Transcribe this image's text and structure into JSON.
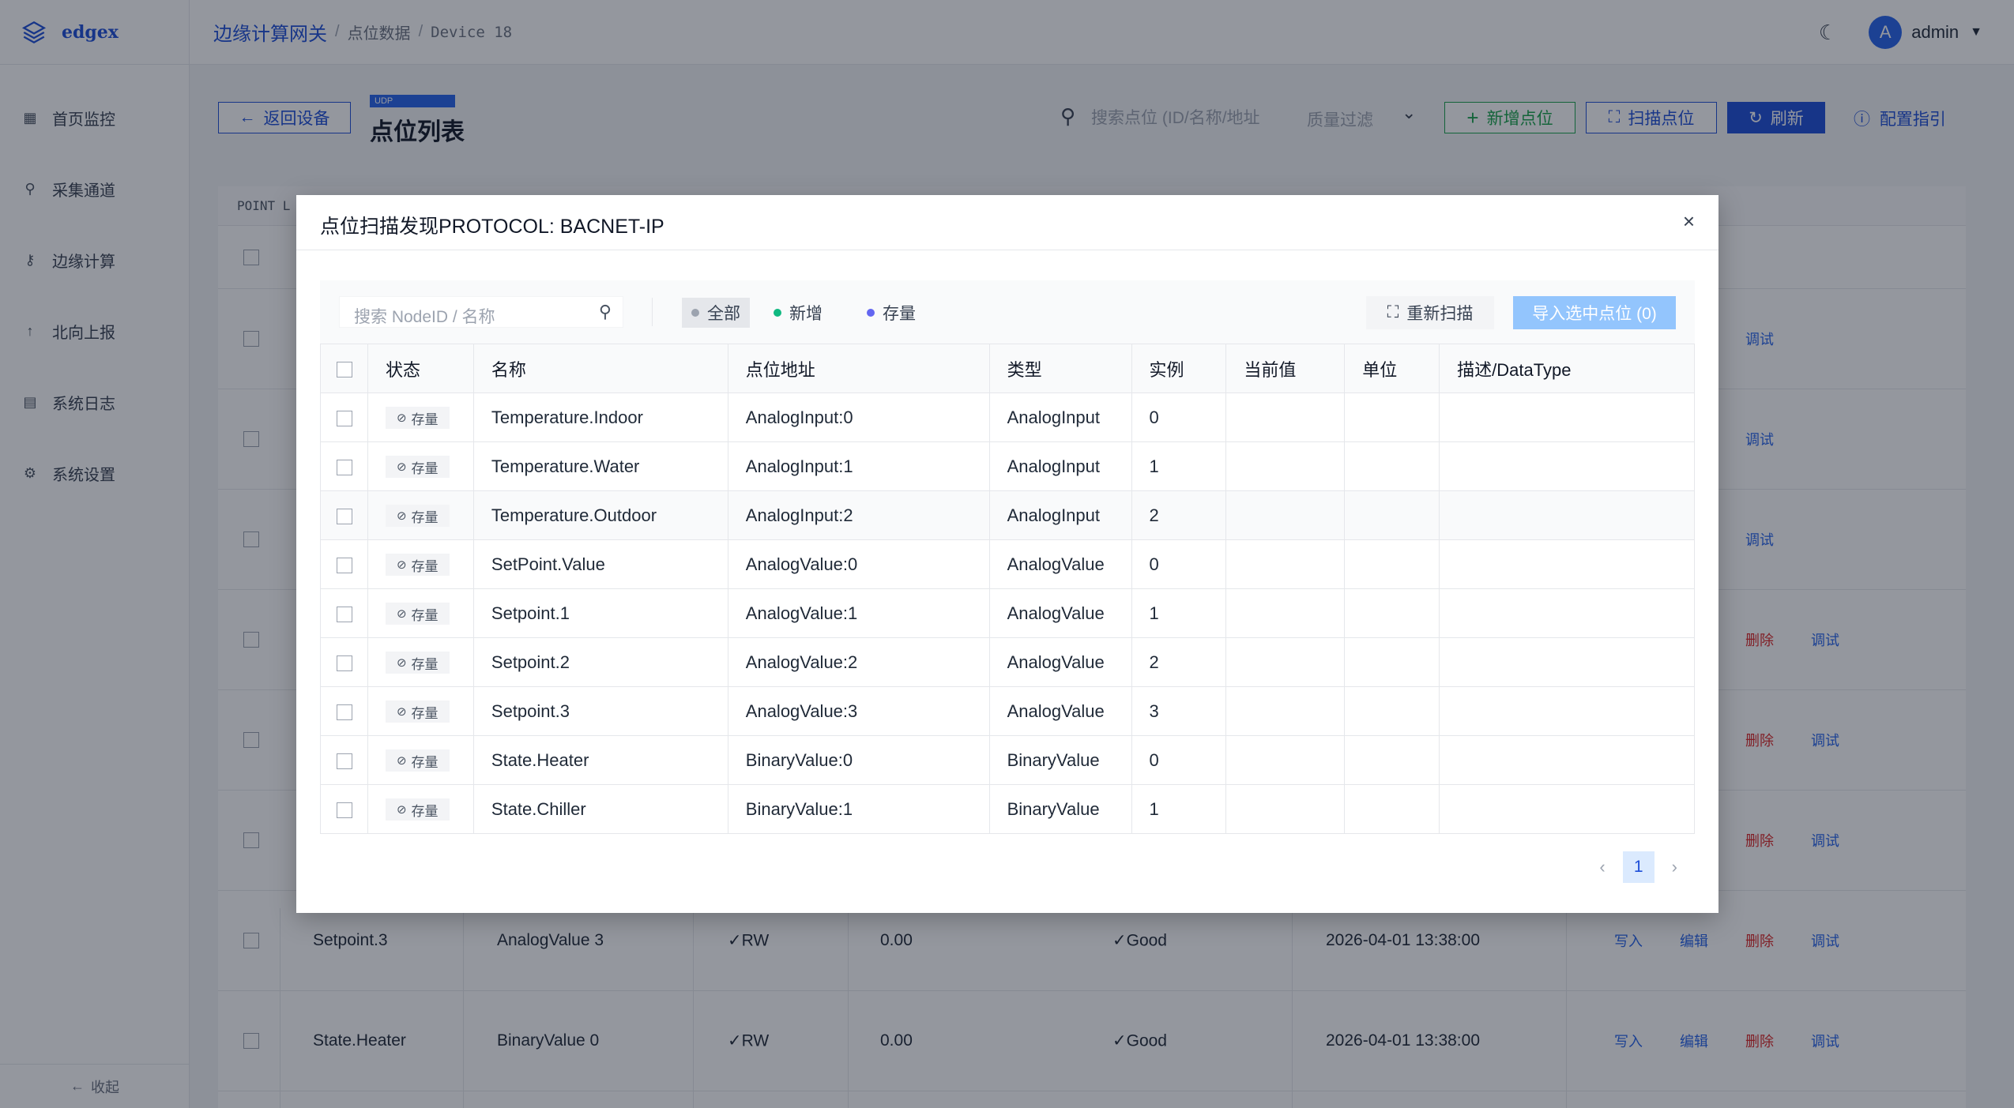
{
  "app": {
    "brand": "edgex"
  },
  "sidebar": {
    "items": [
      {
        "icon": "grid-icon",
        "label": "首页监控"
      },
      {
        "icon": "link-icon",
        "label": "采集通道"
      },
      {
        "icon": "key-icon",
        "label": "边缘计算"
      },
      {
        "icon": "arrow-up-icon",
        "label": "北向上报"
      },
      {
        "icon": "doc-icon",
        "label": "系统日志"
      },
      {
        "icon": "gear-icon",
        "label": "系统设置"
      }
    ],
    "collapse_label": "收起"
  },
  "header": {
    "breadcrumbs": [
      "边缘计算网关",
      "点位数据",
      "Device 18"
    ],
    "user": {
      "initial": "A",
      "name": "admin"
    }
  },
  "toolbar": {
    "back_label": "返回设备",
    "protocol_tag": "UDP",
    "title": "点位列表",
    "search_placeholder": "搜索点位 (ID/名称/地址",
    "quality_filter_placeholder": "质量过滤",
    "add_label": "新增点位",
    "scan_label": "扫描点位",
    "refresh_label": "刷新",
    "guide_label": "配置指引"
  },
  "background_table": {
    "header_fragment": "POINT L",
    "rows": [
      {
        "name": "",
        "address": "",
        "rw": "",
        "value": "",
        "quality": "",
        "time": "",
        "actions": [
          "调试"
        ]
      },
      {
        "name": "",
        "address": "",
        "rw": "",
        "value": "",
        "quality": "",
        "time": "",
        "actions": [
          "调试"
        ]
      },
      {
        "name": "",
        "address": "",
        "rw": "",
        "value": "",
        "quality": "",
        "time": "",
        "actions": [
          "调试"
        ]
      },
      {
        "name": "",
        "address": "",
        "rw": "",
        "value": "",
        "quality": "",
        "time": "",
        "actions": [
          "删除",
          "调试"
        ]
      },
      {
        "name": "",
        "address": "",
        "rw": "",
        "value": "",
        "quality": "",
        "time": "",
        "actions": [
          "删除",
          "调试"
        ]
      },
      {
        "name": "",
        "address": "",
        "rw": "",
        "value": "",
        "quality": "",
        "time": "",
        "actions": [
          "删除",
          "调试"
        ]
      },
      {
        "name": "Setpoint.3",
        "address": "AnalogValue 3",
        "rw": "RW",
        "value": "0.00",
        "quality": "Good",
        "time": "2026-04-01 13:38:00",
        "actions": [
          "写入",
          "编辑",
          "删除",
          "调试"
        ]
      },
      {
        "name": "State.Heater",
        "address": "BinaryValue 0",
        "rw": "RW",
        "value": "0.00",
        "quality": "Good",
        "time": "2026-04-01 13:38:00",
        "actions": [
          "写入",
          "编辑",
          "删除",
          "调试"
        ]
      }
    ]
  },
  "modal": {
    "title": "点位扫描发现PROTOCOL: BACNET-IP",
    "search_placeholder": "搜索 NodeID / 名称",
    "filters": [
      {
        "label": "全部",
        "color": "#9ca3af"
      },
      {
        "label": "新增",
        "color": "#10b981"
      },
      {
        "label": "存量",
        "color": "#6366f1"
      }
    ],
    "rescan_label": "重新扫描",
    "import_label": "导入选中点位 (0)",
    "columns": [
      "状态",
      "名称",
      "点位地址",
      "类型",
      "实例",
      "当前值",
      "单位",
      "描述/DataType"
    ],
    "rows": [
      {
        "status": "存量",
        "name": "Temperature.Indoor",
        "address": "AnalogInput:0",
        "type": "AnalogInput",
        "instance": "0",
        "value": "",
        "unit": "",
        "desc": ""
      },
      {
        "status": "存量",
        "name": "Temperature.Water",
        "address": "AnalogInput:1",
        "type": "AnalogInput",
        "instance": "1",
        "value": "",
        "unit": "",
        "desc": ""
      },
      {
        "status": "存量",
        "name": "Temperature.Outdoor",
        "address": "AnalogInput:2",
        "type": "AnalogInput",
        "instance": "2",
        "value": "",
        "unit": "",
        "desc": ""
      },
      {
        "status": "存量",
        "name": "SetPoint.Value",
        "address": "AnalogValue:0",
        "type": "AnalogValue",
        "instance": "0",
        "value": "",
        "unit": "",
        "desc": ""
      },
      {
        "status": "存量",
        "name": "Setpoint.1",
        "address": "AnalogValue:1",
        "type": "AnalogValue",
        "instance": "1",
        "value": "",
        "unit": "",
        "desc": ""
      },
      {
        "status": "存量",
        "name": "Setpoint.2",
        "address": "AnalogValue:2",
        "type": "AnalogValue",
        "instance": "2",
        "value": "",
        "unit": "",
        "desc": ""
      },
      {
        "status": "存量",
        "name": "Setpoint.3",
        "address": "AnalogValue:3",
        "type": "AnalogValue",
        "instance": "3",
        "value": "",
        "unit": "",
        "desc": ""
      },
      {
        "status": "存量",
        "name": "State.Heater",
        "address": "BinaryValue:0",
        "type": "BinaryValue",
        "instance": "0",
        "value": "",
        "unit": "",
        "desc": ""
      },
      {
        "status": "存量",
        "name": "State.Chiller",
        "address": "BinaryValue:1",
        "type": "BinaryValue",
        "instance": "1",
        "value": "",
        "unit": "",
        "desc": ""
      }
    ],
    "pagination": {
      "current_page": "1"
    }
  }
}
